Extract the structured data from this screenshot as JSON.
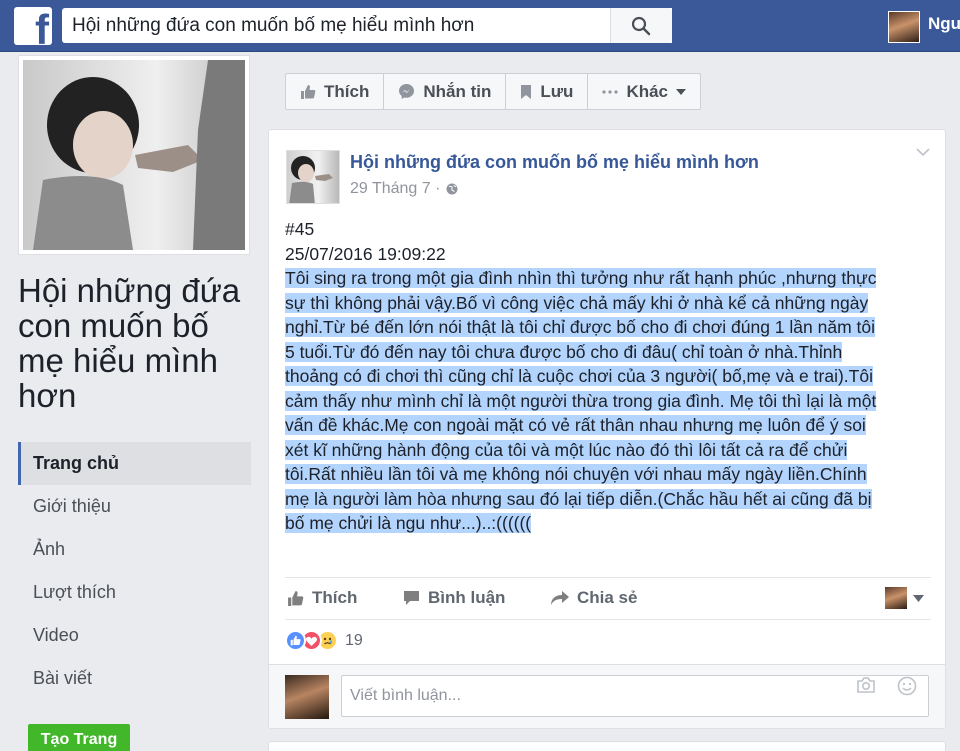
{
  "topbar": {
    "logo_letter": "f",
    "search_value": "Hội những đứa con muốn bố mẹ hiểu mình hơn",
    "user_name": "Ngu"
  },
  "sidebar": {
    "page_name": "Hội những đứa con muốn bố mẹ hiểu mình hơn",
    "items": [
      {
        "label": "Trang chủ",
        "active": true
      },
      {
        "label": "Giới thiệu",
        "active": false
      },
      {
        "label": "Ảnh",
        "active": false
      },
      {
        "label": "Lượt thích",
        "active": false
      },
      {
        "label": "Video",
        "active": false
      },
      {
        "label": "Bài viết",
        "active": false
      }
    ],
    "create_page_label": "Tạo Trang"
  },
  "page_actions": {
    "like": "Thích",
    "message": "Nhắn tin",
    "save": "Lưu",
    "more": "Khác"
  },
  "post": {
    "author": "Hội những đứa con muốn bố mẹ hiểu mình hơn",
    "date": "29 Tháng 7 ·",
    "number": "#45",
    "timestamp": "25/07/2016 19:09:22",
    "lines": [
      "Tôi sing ra trong một gia đình nhìn thì tưởng như rất hạnh phúc ,nhưng thực",
      "sự thì không phải vậy.Bố vì công việc chả mấy khi ở nhà kể cả những ngày",
      "nghỉ.Từ bé đến lớn nói thật là tôi chỉ được bố cho đi chơi đúng 1 lần năm tôi",
      "5 tuổi.Từ đó đến nay tôi chưa được bố cho đi đâu( chỉ toàn ở nhà.Thỉnh",
      "thoảng có đi chơi thì cũng chỉ là cuộc chơi của 3 người( bố,mẹ và e trai).Tôi",
      "cảm thấy như mình chỉ là một người thừa trong gia đình. Mẹ tôi thì lại là một",
      "vấn đề khác.Mẹ con ngoài mặt có vẻ rất thân nhau nhưng mẹ luôn để ý soi",
      "xét kĩ những hành động của tôi và một lúc nào đó thì lôi tất cả ra để chửi",
      "tôi.Rất nhiều lần tôi và mẹ không nói chuyện với nhau mấy ngày liền.Chính",
      "mẹ là người làm hòa nhưng sau đó lại tiếp diễn.(Chắc hầu hết ai cũng đã bị",
      "bố mẹ chửi là ngu như...)..:(((((("
    ],
    "actions": {
      "like": "Thích",
      "comment": "Bình luận",
      "share": "Chia sẻ"
    },
    "reaction_count": "19",
    "comment_placeholder": "Viết bình luận..."
  },
  "colors": {
    "brand": "#3b5998",
    "link": "#365899",
    "selection": "#b3d4fc",
    "create_button": "#42b72a"
  },
  "icons": [
    "facebook-logo",
    "search-icon",
    "like-icon",
    "messenger-icon",
    "bookmark-icon",
    "more-dots-icon",
    "chevron-down-icon",
    "globe-icon",
    "comment-icon",
    "share-icon",
    "like-reaction-icon",
    "love-reaction-icon",
    "sad-reaction-icon",
    "camera-icon",
    "emoji-icon"
  ]
}
